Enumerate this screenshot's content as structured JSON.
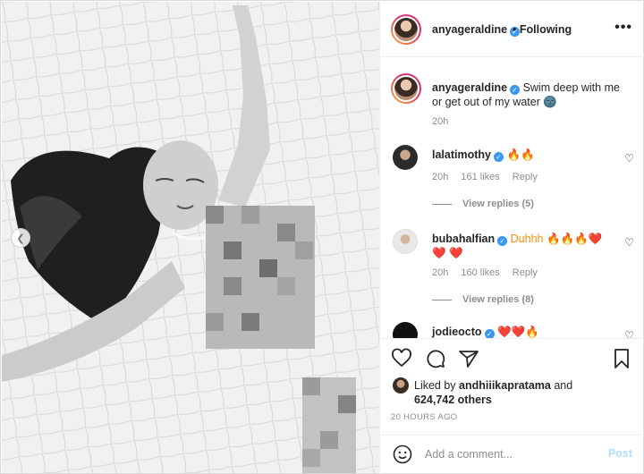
{
  "post": {
    "author": "anyageraldine",
    "follow_status": "• Following",
    "more_glyph": "•••",
    "caption_text": "Swim deep with me or get out of my water 🌚",
    "caption_time": "20h"
  },
  "comments": [
    {
      "user": "lalatimothy",
      "text": "🔥🔥",
      "time": "20h",
      "likes": "161 likes",
      "reply": "Reply",
      "view_replies": "View replies (5)"
    },
    {
      "user": "bubahalfian",
      "text": "Duhhh 🔥🔥🔥❤️❤️ ❤️",
      "time": "20h",
      "likes": "160 likes",
      "reply": "Reply",
      "view_replies": "View replies (8)"
    },
    {
      "user": "jodieocto",
      "text": "❤️❤️🔥"
    }
  ],
  "liked_by": {
    "prefix": "Liked by ",
    "user": "andhiiikapratama",
    "suffix": " and",
    "count": "624,742 others"
  },
  "posted_ago": "20 HOURS AGO",
  "comment_box": {
    "placeholder": "Add a comment...",
    "post_label": "Post"
  },
  "icons": {
    "verified": "verified-badge-icon",
    "like": "heart-icon",
    "comment": "comment-bubble-icon",
    "share": "paper-plane-icon",
    "save": "bookmark-icon",
    "emoji": "smiley-icon",
    "prev": "chevron-left-icon"
  },
  "colors": {
    "verified": "#3897f0",
    "post_button": "#b2dffc",
    "meta_text": "#8e8e8e"
  }
}
